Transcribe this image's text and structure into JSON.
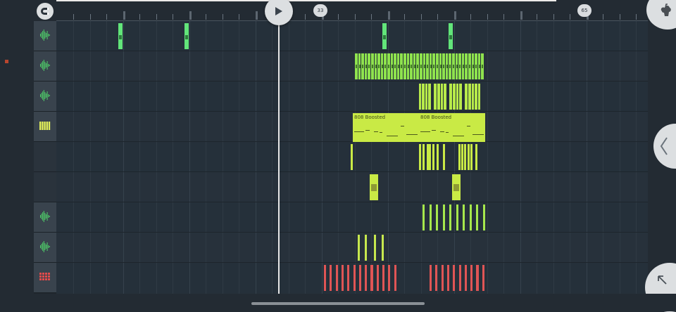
{
  "ruler": {
    "markers": [
      {
        "label": "33",
        "bar": 33
      },
      {
        "label": "65",
        "bar": 65
      }
    ]
  },
  "tracks": [
    {
      "icon": "audio-waveform-icon",
      "kind": "audio"
    },
    {
      "icon": "audio-waveform-icon",
      "kind": "audio"
    },
    {
      "icon": "audio-waveform-icon",
      "kind": "audio"
    },
    {
      "icon": "piano-keys-icon",
      "kind": "piano"
    },
    {
      "icon": "",
      "kind": "empty"
    },
    {
      "icon": "",
      "kind": "empty"
    },
    {
      "icon": "audio-waveform-icon",
      "kind": "audio"
    },
    {
      "icon": "audio-waveform-icon",
      "kind": "audio"
    },
    {
      "icon": "drum-pattern-icon",
      "kind": "drums"
    }
  ],
  "clips": {
    "pattern_clips": [
      {
        "label": "808 Boosted"
      },
      {
        "label": "808 Boosted"
      }
    ]
  },
  "colors": {
    "background": "#232b33",
    "playlist": "#26303a",
    "clip_green": "#62e57a",
    "clip_lime": "#8fe34e",
    "clip_yellow": "#c9ea45",
    "clip_red": "#e05555",
    "button": "#dcdfe1"
  }
}
